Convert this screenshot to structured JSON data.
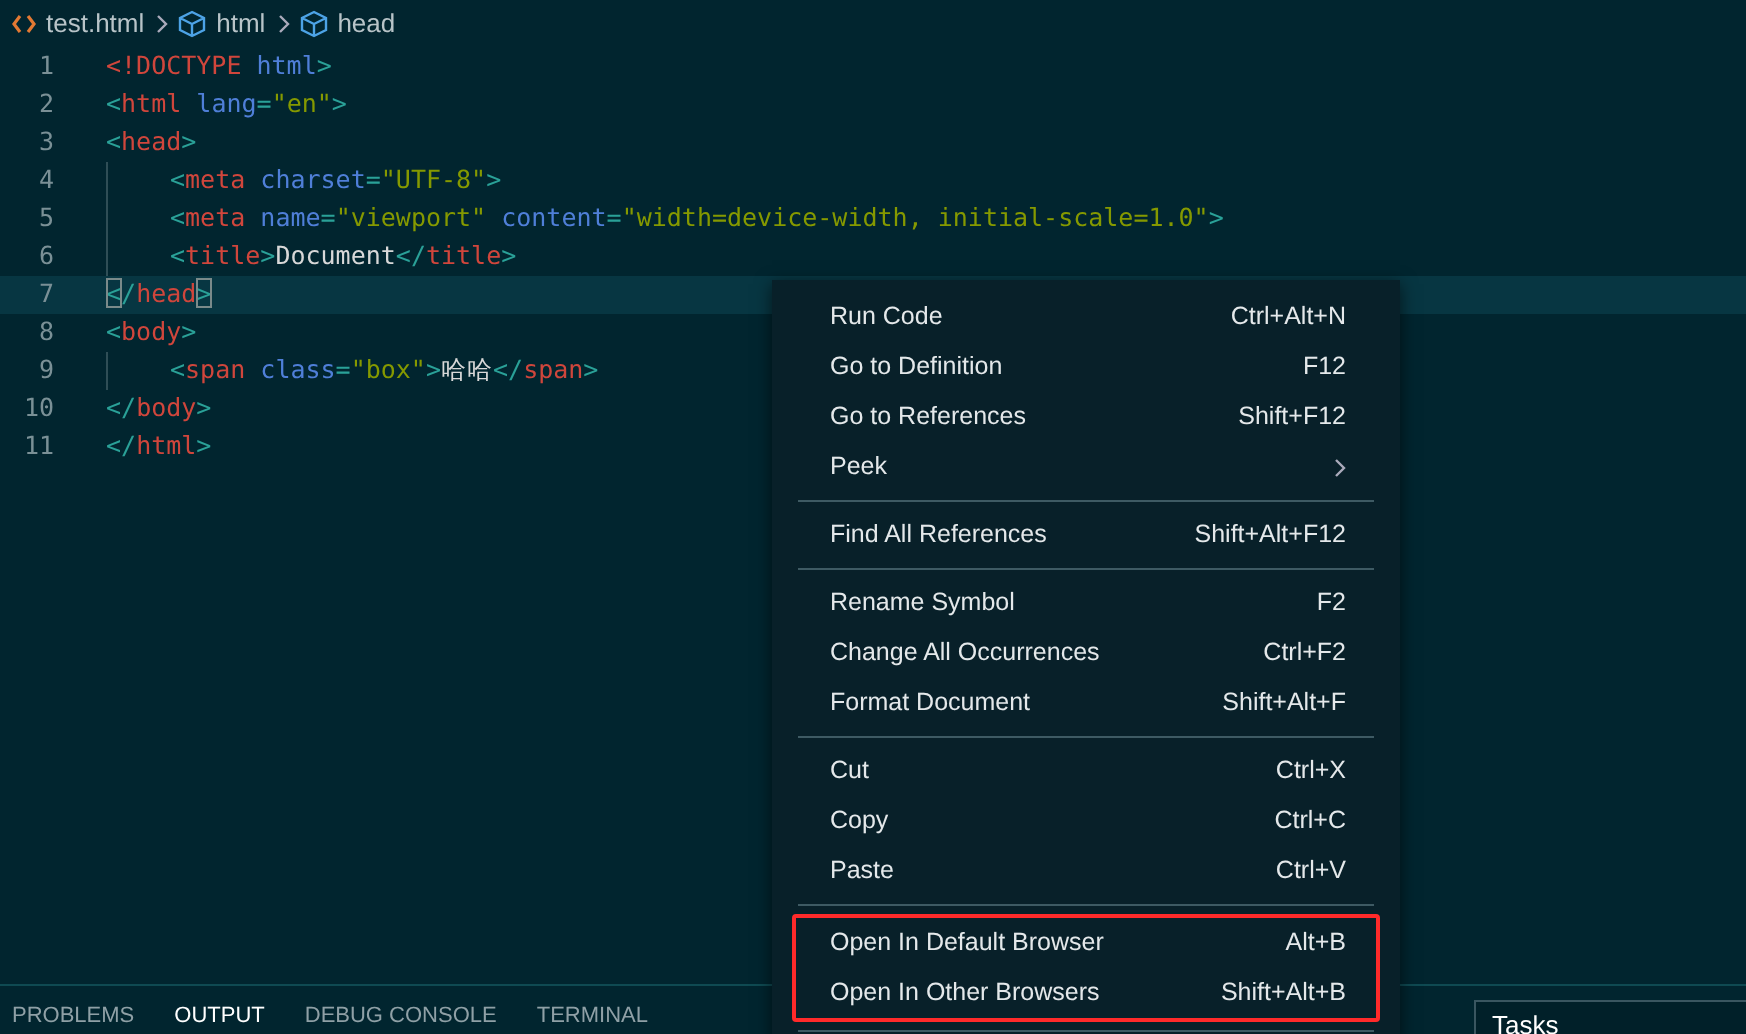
{
  "breadcrumb": [
    {
      "kind": "file",
      "label": "test.html"
    },
    {
      "kind": "element",
      "label": "html"
    },
    {
      "kind": "element",
      "label": "head"
    }
  ],
  "editor": {
    "lines": [
      {
        "number": "1",
        "current": false,
        "indent": false,
        "tokens": [
          {
            "kind": "tag",
            "text": "<!DOCTYPE"
          },
          {
            "kind": "attr",
            "text": " html"
          },
          {
            "kind": "punct",
            "text": ">"
          }
        ]
      },
      {
        "number": "2",
        "current": false,
        "indent": false,
        "tokens": [
          {
            "kind": "punct",
            "text": "<"
          },
          {
            "kind": "tag",
            "text": "html"
          },
          {
            "kind": "attr",
            "text": " lang"
          },
          {
            "kind": "punct",
            "text": "="
          },
          {
            "kind": "string",
            "text": "\"en\""
          },
          {
            "kind": "punct",
            "text": ">"
          }
        ]
      },
      {
        "number": "3",
        "current": false,
        "indent": false,
        "tokens": [
          {
            "kind": "punct",
            "text": "<"
          },
          {
            "kind": "tag",
            "text": "head"
          },
          {
            "kind": "punct",
            "text": ">"
          }
        ]
      },
      {
        "number": "4",
        "current": false,
        "indent": true,
        "tokens": [
          {
            "kind": "punct",
            "text": "<"
          },
          {
            "kind": "tag",
            "text": "meta"
          },
          {
            "kind": "attr",
            "text": " charset"
          },
          {
            "kind": "punct",
            "text": "="
          },
          {
            "kind": "string",
            "text": "\"UTF-8\""
          },
          {
            "kind": "punct",
            "text": ">"
          }
        ]
      },
      {
        "number": "5",
        "current": false,
        "indent": true,
        "tokens": [
          {
            "kind": "punct",
            "text": "<"
          },
          {
            "kind": "tag",
            "text": "meta"
          },
          {
            "kind": "attr",
            "text": " name"
          },
          {
            "kind": "punct",
            "text": "="
          },
          {
            "kind": "string",
            "text": "\"viewport\""
          },
          {
            "kind": "attr",
            "text": " content"
          },
          {
            "kind": "punct",
            "text": "="
          },
          {
            "kind": "string",
            "text": "\"width=device-width, initial-scale=1.0\""
          },
          {
            "kind": "punct",
            "text": ">"
          }
        ]
      },
      {
        "number": "6",
        "current": false,
        "indent": true,
        "tokens": [
          {
            "kind": "punct",
            "text": "<"
          },
          {
            "kind": "tag",
            "text": "title"
          },
          {
            "kind": "punct",
            "text": ">"
          },
          {
            "kind": "text",
            "text": "Document"
          },
          {
            "kind": "punct",
            "text": "</"
          },
          {
            "kind": "tag",
            "text": "title"
          },
          {
            "kind": "punct",
            "text": ">"
          }
        ]
      },
      {
        "number": "7",
        "current": true,
        "indent": false,
        "tokens": [
          {
            "kind": "match",
            "text": "<"
          },
          {
            "kind": "punct",
            "text": "/"
          },
          {
            "kind": "tag",
            "text": "head"
          },
          {
            "kind": "match",
            "text": ">"
          }
        ]
      },
      {
        "number": "8",
        "current": false,
        "indent": false,
        "tokens": [
          {
            "kind": "punct",
            "text": "<"
          },
          {
            "kind": "tag",
            "text": "body"
          },
          {
            "kind": "punct",
            "text": ">"
          }
        ]
      },
      {
        "number": "9",
        "current": false,
        "indent": true,
        "tokens": [
          {
            "kind": "punct",
            "text": "<"
          },
          {
            "kind": "tag",
            "text": "span"
          },
          {
            "kind": "attr",
            "text": " class"
          },
          {
            "kind": "punct",
            "text": "="
          },
          {
            "kind": "string",
            "text": "\"box\""
          },
          {
            "kind": "punct",
            "text": ">"
          },
          {
            "kind": "text",
            "text": "哈哈"
          },
          {
            "kind": "punct",
            "text": "</"
          },
          {
            "kind": "tag",
            "text": "span"
          },
          {
            "kind": "punct",
            "text": ">"
          }
        ]
      },
      {
        "number": "10",
        "current": false,
        "indent": false,
        "tokens": [
          {
            "kind": "punct",
            "text": "</"
          },
          {
            "kind": "tag",
            "text": "body"
          },
          {
            "kind": "punct",
            "text": ">"
          }
        ]
      },
      {
        "number": "11",
        "current": false,
        "indent": false,
        "tokens": [
          {
            "kind": "punct",
            "text": "</"
          },
          {
            "kind": "tag",
            "text": "html"
          },
          {
            "kind": "punct",
            "text": ">"
          }
        ]
      }
    ]
  },
  "context_menu": {
    "groups": [
      {
        "highlighted": false,
        "items": [
          {
            "label": "Run Code",
            "shortcut": "Ctrl+Alt+N",
            "submenu": false
          },
          {
            "label": "Go to Definition",
            "shortcut": "F12",
            "submenu": false
          },
          {
            "label": "Go to References",
            "shortcut": "Shift+F12",
            "submenu": false
          },
          {
            "label": "Peek",
            "submenu": true
          }
        ]
      },
      {
        "highlighted": false,
        "items": [
          {
            "label": "Find All References",
            "shortcut": "Shift+Alt+F12",
            "submenu": false
          }
        ]
      },
      {
        "highlighted": false,
        "items": [
          {
            "label": "Rename Symbol",
            "shortcut": "F2",
            "submenu": false
          },
          {
            "label": "Change All Occurrences",
            "shortcut": "Ctrl+F2",
            "submenu": false
          },
          {
            "label": "Format Document",
            "shortcut": "Shift+Alt+F",
            "submenu": false
          }
        ]
      },
      {
        "highlighted": false,
        "items": [
          {
            "label": "Cut",
            "shortcut": "Ctrl+X",
            "submenu": false
          },
          {
            "label": "Copy",
            "shortcut": "Ctrl+C",
            "submenu": false
          },
          {
            "label": "Paste",
            "shortcut": "Ctrl+V",
            "submenu": false
          }
        ]
      },
      {
        "highlighted": true,
        "items": [
          {
            "label": "Open In Default Browser",
            "shortcut": "Alt+B",
            "submenu": false
          },
          {
            "label": "Open In Other Browsers",
            "shortcut": "Shift+Alt+B",
            "submenu": false
          }
        ]
      }
    ]
  },
  "panel": {
    "tabs": [
      {
        "label": "PROBLEMS",
        "selected": false
      },
      {
        "label": "OUTPUT",
        "selected": true
      },
      {
        "label": "DEBUG CONSOLE",
        "selected": false
      },
      {
        "label": "TERMINAL",
        "selected": false
      }
    ],
    "dropdown": {
      "value": "Tasks"
    }
  }
}
